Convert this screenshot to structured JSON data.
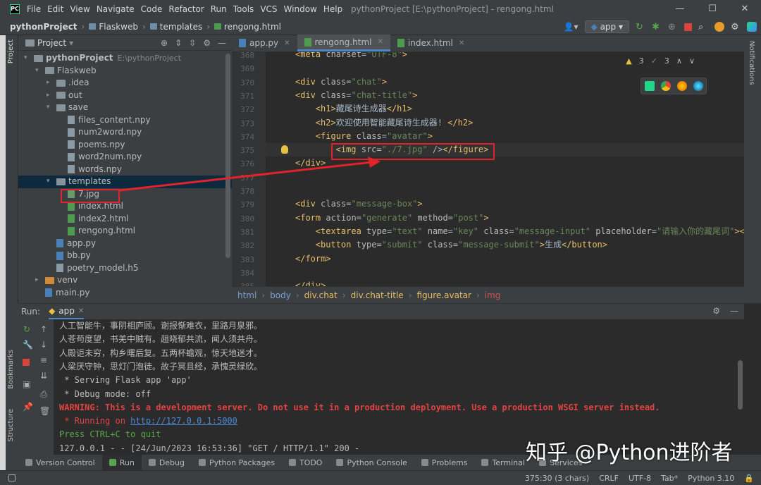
{
  "window": {
    "title": "pythonProject [E:\\pythonProject] - rengong.html",
    "menu": [
      "File",
      "Edit",
      "View",
      "Navigate",
      "Code",
      "Refactor",
      "Run",
      "Tools",
      "VCS",
      "Window",
      "Help"
    ]
  },
  "breadcrumb": [
    "pythonProject",
    "Flaskweb",
    "templates",
    "rengong.html"
  ],
  "run_config": "app",
  "project_panel": {
    "title": "Project",
    "tree": [
      {
        "label": "pythonProject",
        "extra": "E:\\pythonProject",
        "depth": 0,
        "kind": "folder",
        "open": true
      },
      {
        "label": "Flaskweb",
        "depth": 1,
        "kind": "folder",
        "open": true
      },
      {
        "label": ".idea",
        "depth": 2,
        "kind": "folder",
        "open": false
      },
      {
        "label": "out",
        "depth": 2,
        "kind": "folder",
        "open": false
      },
      {
        "label": "save",
        "depth": 2,
        "kind": "folder",
        "open": true
      },
      {
        "label": "files_content.npy",
        "depth": 3,
        "kind": "file"
      },
      {
        "label": "num2word.npy",
        "depth": 3,
        "kind": "file"
      },
      {
        "label": "poems.npy",
        "depth": 3,
        "kind": "file"
      },
      {
        "label": "word2num.npy",
        "depth": 3,
        "kind": "file"
      },
      {
        "label": "words.npy",
        "depth": 3,
        "kind": "file"
      },
      {
        "label": "templates",
        "depth": 2,
        "kind": "folder",
        "open": true,
        "selected": true
      },
      {
        "label": "7.jpg",
        "depth": 3,
        "kind": "img"
      },
      {
        "label": "index.html",
        "depth": 3,
        "kind": "html"
      },
      {
        "label": "index2.html",
        "depth": 3,
        "kind": "html"
      },
      {
        "label": "rengong.html",
        "depth": 3,
        "kind": "html"
      },
      {
        "label": "app.py",
        "depth": 2,
        "kind": "py"
      },
      {
        "label": "bb.py",
        "depth": 2,
        "kind": "py"
      },
      {
        "label": "poetry_model.h5",
        "depth": 2,
        "kind": "file"
      },
      {
        "label": "venv",
        "depth": 1,
        "kind": "folder-orange",
        "open": false
      },
      {
        "label": "main.py",
        "depth": 1,
        "kind": "py"
      }
    ]
  },
  "editor": {
    "tabs": [
      {
        "label": "app.py",
        "active": false
      },
      {
        "label": "rengong.html",
        "active": true
      },
      {
        "label": "index.html",
        "active": false
      }
    ],
    "line_numbers": [
      "368",
      "369",
      "370",
      "371",
      "372",
      "373",
      "374",
      "375",
      "376",
      "377",
      "378",
      "379",
      "380",
      "381",
      "382",
      "383",
      "384",
      "385"
    ],
    "lines": [
      "<meta charset=\"UTF-8\">",
      "",
      "<div class=\"chat\">",
      "<div class=\"chat-title\">",
      "    <h1>藏尾诗生成器</h1>",
      "    <h2>欢迎使用智能藏尾诗生成器! </h2>",
      "    <figure class=\"avatar\">",
      "        <img src=\"./7.jpg\" /></figure>",
      "</div>",
      "",
      "",
      "<div class=\"message-box\">",
      "<form action=\"generate\" method=\"post\">",
      "    <textarea type=\"text\" name=\"key\" class=\"message-input\" placeholder=\"请输入你的藏尾词\"></te",
      "    <button type=\"submit\" class=\"message-submit\">生成</button>",
      "</form>",
      "",
      "</div>"
    ],
    "inspections": {
      "warnings": "3",
      "weak": "3"
    },
    "path": [
      "html",
      "body",
      "div.chat",
      "div.chat-title",
      "figure.avatar",
      "img"
    ]
  },
  "run_panel": {
    "label": "Run:",
    "tab": "app",
    "output": [
      {
        "text": "人工智能牛，事阴相庐顾。谢报惭难衣，里路月泉邪。",
        "style": "normal"
      },
      {
        "text": "人苍苟度望，书羌中贼有。趄晓郁共流，闻人须共舟。",
        "style": "normal"
      },
      {
        "text": "人殿讵未穷，构乡曙后复。五两杯蟾观，惊天地迷才。",
        "style": "normal"
      },
      {
        "text": "人梁厌守钟，思灯门泡徒。故子冥且经，承愧灵绿欣。",
        "style": "normal"
      },
      {
        "text": " * Serving Flask app 'app'",
        "style": "normal"
      },
      {
        "text": " * Debug mode: off",
        "style": "normal"
      },
      {
        "text": "WARNING: This is a development server. Do not use it in a production deployment. Use a production WSGI server instead.",
        "style": "warn"
      },
      {
        "text": " * Running on ",
        "style": "warn-plain",
        "link": "http://127.0.0.1:5000"
      },
      {
        "text": "Press CTRL+C to quit",
        "style": "green"
      },
      {
        "text": "127.0.0.1 - - [24/Jun/2023 16:53:36] \"GET / HTTP/1.1\" 200 -",
        "style": "normal"
      }
    ]
  },
  "tool_windows": [
    "Version Control",
    "Run",
    "Debug",
    "Python Packages",
    "TODO",
    "Python Console",
    "Problems",
    "Terminal",
    "Services"
  ],
  "side_tabs": {
    "left_top": "Project",
    "left_bottom_1": "Bookmarks",
    "left_bottom_2": "Structure",
    "right": "Notifications"
  },
  "status": {
    "position": "375:30 (3 chars)",
    "line_ending": "CRLF",
    "encoding": "UTF-8",
    "indent": "Tab*",
    "interpreter": "Python 3.10"
  },
  "watermark": "知乎 @Python进阶者",
  "colors": {
    "accent": "#4a88c7",
    "annotation": "#e0242a",
    "warning": "#e24444"
  }
}
